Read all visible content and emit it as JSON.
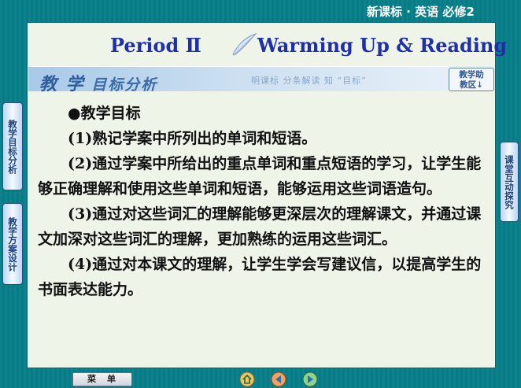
{
  "header": {
    "course": "新课标 · 英语    必修2"
  },
  "title": {
    "period": "Period  Ⅱ",
    "lesson": "Warming Up & Reading"
  },
  "section": {
    "heading_big": "教 学",
    "heading_rest": "目标分析",
    "slogan": "明课标   分条解读   知 “目标”",
    "help_button": "教学助\n教区↓"
  },
  "content": {
    "heading": "●教学目标",
    "items": [
      "(1)熟记学案中所列出的单词和短语。",
      "(2)通过学案中所给出的重点单词和重点短语的学习，让学生能够正确理解和使用这些单词和短语，能够运用这些词语造句。",
      "(3)通过对这些词汇的理解能够更深层次的理解课文，并通过课文加深对这些词汇的理解，更加熟练的运用这些词汇。",
      "(4)通过对本课文的理解，让学生学会写建议信，以提高学生的书面表达能力。"
    ]
  },
  "side_tabs": {
    "left_1": "教学目标分析",
    "left_2": "教学方案设计",
    "right_1": "课堂互动探究"
  },
  "bottom": {
    "menu": "菜单"
  },
  "colors": {
    "frame": "#0a7f89",
    "panel": "#eef4e8",
    "title_blue": "#1f2fa8"
  },
  "icons": [
    "feather-icon",
    "home-icon",
    "back-icon",
    "forward-icon"
  ]
}
